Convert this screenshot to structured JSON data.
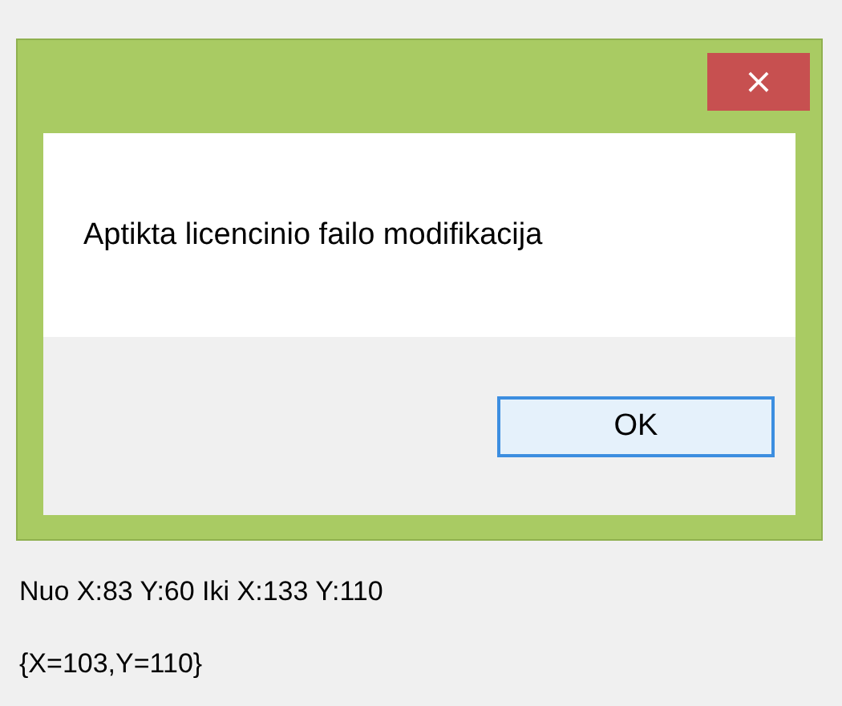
{
  "dialog": {
    "close_button": "×",
    "message": "Aptikta licencinio failo modifikacija",
    "buttons": [
      "OK"
    ]
  },
  "labels": [
    "Nuo X:83 Y:60 Iki X:133 Y:110",
    "{X=103,Y=110}"
  ]
}
